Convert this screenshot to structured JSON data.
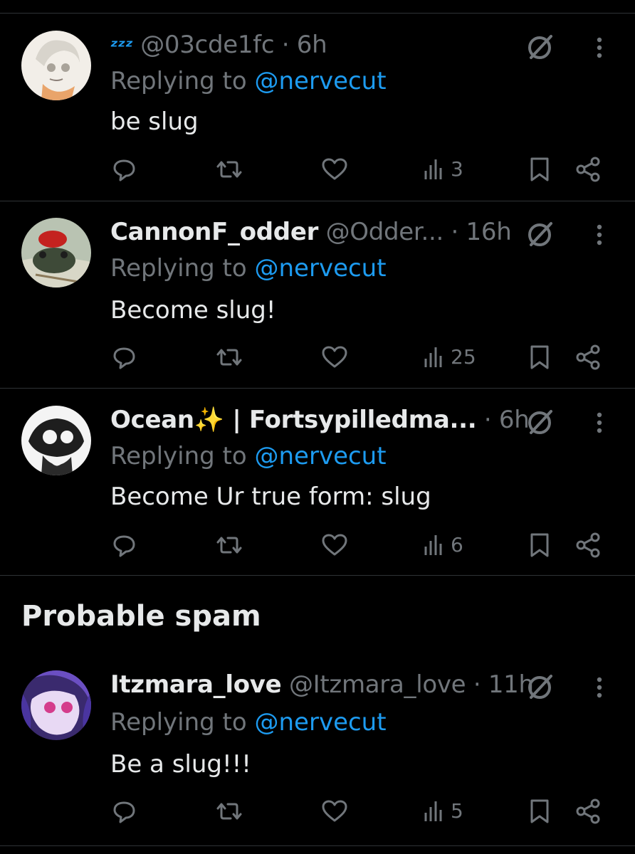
{
  "replies": [
    {
      "display_name": "",
      "status_emoji": "ᶻᶻᶻ",
      "handle": "@03cde1fc",
      "time": "6h",
      "reply_prefix": "Replying to",
      "reply_to": "@nervecut",
      "text": "be slug",
      "views": "3"
    },
    {
      "display_name": "CannonF_odder",
      "handle": "@Odder...",
      "time": "16h",
      "reply_prefix": "Replying to",
      "reply_to": "@nervecut",
      "text": "Become slug!",
      "views": "25"
    },
    {
      "display_name": "Ocean✨ | Fortsypilledma...",
      "handle": "",
      "time": "6h",
      "reply_prefix": "Replying to",
      "reply_to": "@nervecut",
      "text": "Become Ur true form: slug",
      "views": "6"
    }
  ],
  "spam_section": {
    "title": "Probable spam",
    "reply": {
      "display_name": "Itzmara_love",
      "handle": "@Itzmara_love",
      "time": "11h",
      "reply_prefix": "Replying to",
      "reply_to": "@nervecut",
      "text": "Be a slug!!!",
      "views": "5"
    }
  },
  "icons": {
    "reply": "reply-icon",
    "repost": "repost-icon",
    "like": "heart-icon",
    "views": "views-icon",
    "bookmark": "bookmark-icon",
    "share": "share-icon",
    "grok": "grok-icon",
    "more": "more-icon"
  },
  "colors": {
    "background": "#000000",
    "text": "#e7e9ea",
    "muted": "#71767b",
    "accent": "#1d9bf0",
    "divider": "#2f3336"
  }
}
